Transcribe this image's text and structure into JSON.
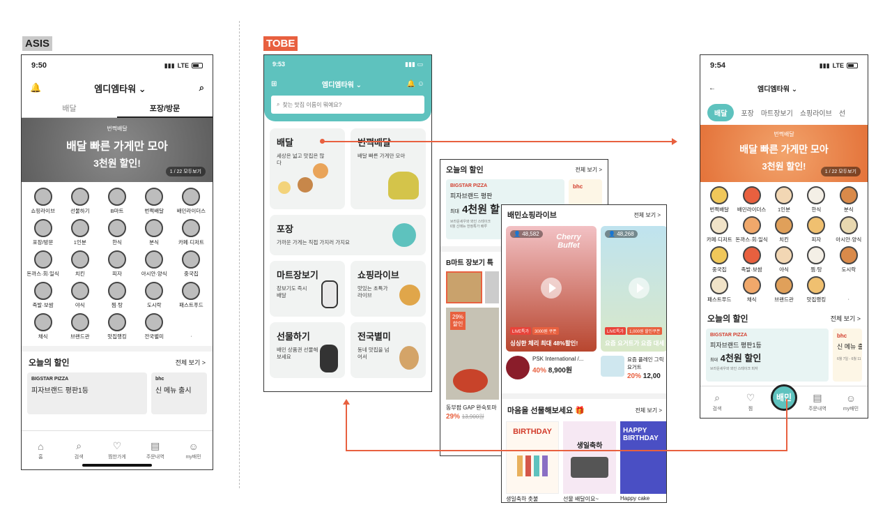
{
  "labels": {
    "asis": "ASIS",
    "tobe": "TOBE"
  },
  "asis": {
    "time": "9:50",
    "network": "LTE",
    "location": "엠디엠타워",
    "tabs": [
      "배달",
      "포장/방문"
    ],
    "banner": {
      "small": "번쩍배달",
      "line1": "배달 빠른 가게만 모아",
      "line2": "3천원 할인!",
      "pager": "1 / 22 모두보기"
    },
    "categories": [
      "쇼핑라이브",
      "선물하기",
      "B마트",
      "번쩍배달",
      "배민라이더스",
      "포장/방문",
      "1인분",
      "한식",
      "분식",
      "카페·디저트",
      "돈까스·회·일식",
      "치킨",
      "피자",
      "아시안·양식",
      "중국집",
      "족발·보쌈",
      "야식",
      "찜·탕",
      "도시락",
      "패스트푸드",
      "채식",
      "브랜드관",
      "맛집랭킹",
      "전국별미",
      "·"
    ],
    "section": {
      "title": "오늘의 할인",
      "more": "전체 보기 >"
    },
    "promo": {
      "brand": "BIGSTAR PIZZA",
      "text": "피자브랜드 평판1등",
      "brand2": "bhc",
      "text2": "신 메뉴 출시"
    },
    "nav": [
      "홈",
      "검색",
      "찜한가게",
      "주문내역",
      "my배민"
    ]
  },
  "tobe": {
    "time": "9:53",
    "location": "엠디엠타워",
    "search_placeholder": "찾는 맛집 이름이 뭐예요?",
    "cards": {
      "delivery": {
        "title": "배달",
        "sub": "세상은 넓고 맛집은 많다"
      },
      "fast": {
        "title": "번쩍배달",
        "sub": "배달 빠른 가게만 모아"
      },
      "pickup": {
        "title": "포장",
        "sub": "가까운 가게는 직접 가지러 가지요"
      },
      "mart": {
        "title": "마트장보기",
        "sub": "장보기도 즉시배달"
      },
      "live": {
        "title": "쇼핑라이브",
        "sub": "맛있는 초특가 라이브"
      },
      "gift": {
        "title": "선물하기",
        "sub": "배민 상품권 선물해 보세요"
      },
      "local": {
        "title": "전국별미",
        "sub": "동네 맛집을 넘어서"
      }
    }
  },
  "shop": {
    "section1": {
      "title": "오늘의 할인",
      "more": "전체 보기 >"
    },
    "promo": {
      "brand": "BIGSTAR PIZZA",
      "line1": "피자브랜드 평판",
      "line2": "4천원 할",
      "prefix": "최대",
      "note": "브라운세우와 와인 스테이크",
      "note2": "6월 신메뉴 한정특가 배루",
      "brand2": "bhc"
    },
    "bmart": {
      "title": "B마트 장보기 특",
      "badge": "29%\n할인",
      "item": "동부팜 GAP 완숙토마",
      "price": "29%",
      "old": "13,900원"
    },
    "live": {
      "title": "배민쇼핑라이브",
      "more": "전체 보기 >",
      "card1": {
        "viewers": "48,582",
        "badge1": "LIVE특가",
        "badge2": "3000원 쿠폰",
        "title": "싱싱한 체리 최대 48%할인!",
        "sign": "Cherry Buffet"
      },
      "card2": {
        "viewers": "48,268",
        "badge1": "LIVE특가",
        "badge2": "1,000원 할인쿠폰",
        "title": "요즘 요거트가 요즘 대세"
      },
      "prod1": {
        "name": "PSK International /...",
        "pct": "40%",
        "price": "8,900원"
      },
      "prod2": {
        "name": "요즘 플레인 그릭요거트",
        "pct": "20%",
        "price": "12,00"
      }
    },
    "gift": {
      "title": "마음을 선물해보세요",
      "more": "전체 보기 >",
      "items": [
        "생일축하 촛불",
        "선물 배달이요~",
        "Happy cake"
      ],
      "card1": "BIRTHDAY",
      "card2": "생일축하",
      "card3": "HAPPY BIRTHDAY"
    }
  },
  "right": {
    "time": "9:54",
    "network": "LTE",
    "location": "엠디엠타워",
    "tabs": [
      "배달",
      "포장",
      "마트장보기",
      "쇼핑라이브",
      "선"
    ],
    "banner": {
      "small": "번쩍배달",
      "line1": "배달 빠른 가게만 모아",
      "line2": "3천원 할인!",
      "pager": "1 / 22 모두보기"
    },
    "categories": [
      "번쩍배달",
      "배민라이더스",
      "1인분",
      "한식",
      "분식",
      "카페·디저트",
      "돈까스·회·일식",
      "치킨",
      "피자",
      "아시안·양식",
      "중국집",
      "족발·보쌈",
      "야식",
      "찜·탕",
      "도시락",
      "패스트푸드",
      "채식",
      "브랜드관",
      "맛집랭킹",
      "·"
    ],
    "section": {
      "title": "오늘의 할인",
      "more": "전체 보기 >"
    },
    "promo": {
      "brand": "BIGSTAR PIZZA",
      "line1": "피자브랜드 평판1등",
      "line2": "4천원 할인",
      "prefix": "최대",
      "note": "브라운세우와 와인 스테이크 피자",
      "brand2": "bhc",
      "text2": "신 메뉴 출",
      "date": "6월 7일 - 6월 11"
    },
    "nav": [
      "검색",
      "찜",
      "배민",
      "주문내역",
      "my배민"
    ]
  },
  "colors": {
    "teal": "#5ec2be",
    "accent": "#e8603f"
  }
}
